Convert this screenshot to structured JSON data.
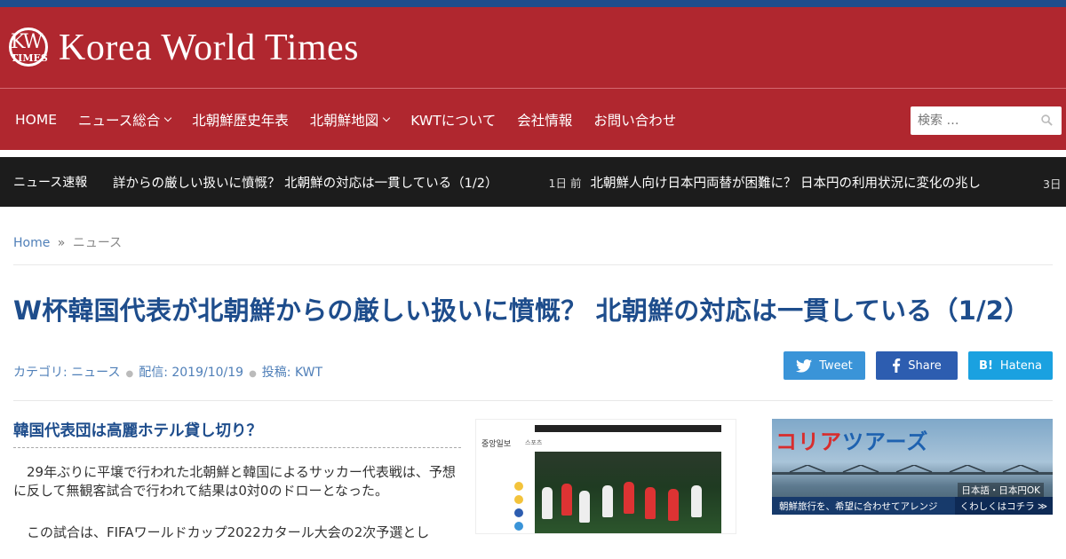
{
  "site": {
    "title": "Korea World Times",
    "logo_kw": "KW",
    "logo_times": "TIMES"
  },
  "nav": {
    "items": [
      {
        "label": "HOME",
        "dropdown": false
      },
      {
        "label": "ニュース総合",
        "dropdown": true
      },
      {
        "label": "北朝鮮歴史年表",
        "dropdown": false
      },
      {
        "label": "北朝鮮地図",
        "dropdown": true
      },
      {
        "label": "KWTについて",
        "dropdown": false
      },
      {
        "label": "会社情報",
        "dropdown": false
      },
      {
        "label": "お問い合わせ",
        "dropdown": false
      }
    ],
    "search_placeholder": "検索 …"
  },
  "ticker": {
    "label": "ニュース速報",
    "item1": "詳からの厳しい扱いに憤慨？ 北朝鮮の対応は一貫している（1/2）",
    "time2": "1日 前",
    "item2": "北朝鮮人向け日本円両替が困難に？ 日本円の利用状況に変化の兆し",
    "time3": "3日"
  },
  "breadcrumb": {
    "home": "Home",
    "sep": "»",
    "current": "ニュース"
  },
  "article": {
    "title": "W杯韓国代表が北朝鮮からの厳しい扱いに憤慨？ 北朝鮮の対応は一貫している（1/2）",
    "category": "カテゴリ: ニュース",
    "date": "配信: 2019/10/19",
    "author": "投稿: KWT",
    "subheading": "韓国代表団は高麗ホテル貸し切り？",
    "para1": "　29年ぶりに平壌で行われた北朝鮮と韓国によるサッカー代表戦は、予想に反して無観客試合で行われて結果は0対0のドローとなった。",
    "para2": "　この試合は、FIFAワールドカップ2022カタール大会の2次予選とし"
  },
  "share": {
    "tweet": "Tweet",
    "facebook": "Share",
    "hatena": "Hatena"
  },
  "photo": {
    "paper_logo": "중앙일보",
    "section": "스포츠"
  },
  "ad": {
    "title_a": "コリア",
    "title_b": "ツアーズ",
    "badge": "日本語・日本円OK",
    "bottom_left": "朝鮮旅行を、希望に合わせてアレンジ",
    "bottom_right": "くわしくはコチラ ≫"
  },
  "colors": {
    "brand_red": "#b0272f",
    "title_blue": "#1e4d8c",
    "ticker_bg": "#1c1c1c"
  }
}
